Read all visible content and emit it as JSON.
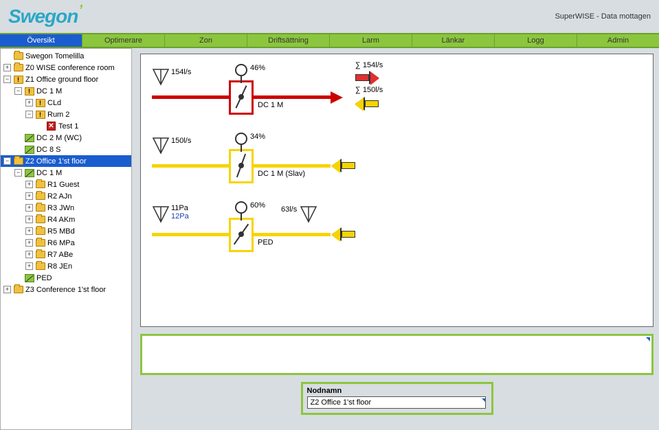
{
  "header": {
    "logo": "Swegon",
    "status": "SuperWISE - Data mottagen"
  },
  "nav": {
    "items": [
      "Översikt",
      "Optimerare",
      "Zon",
      "Driftsättning",
      "Larm",
      "Länkar",
      "Logg",
      "Admin"
    ],
    "activeIndex": 0
  },
  "tree": [
    {
      "lvl": 0,
      "toggle": "",
      "icon": "folder",
      "label": "Swegon Tomelilla"
    },
    {
      "lvl": 0,
      "toggle": "+",
      "icon": "folder",
      "label": "Z0 WISE conference room"
    },
    {
      "lvl": 0,
      "toggle": "-",
      "icon": "warn",
      "label": "Z1 Office ground floor"
    },
    {
      "lvl": 1,
      "toggle": "-",
      "icon": "warn",
      "label": "DC 1 M"
    },
    {
      "lvl": 2,
      "toggle": "+",
      "icon": "warn",
      "label": "CLd"
    },
    {
      "lvl": 2,
      "toggle": "-",
      "icon": "warn",
      "label": "Rum 2"
    },
    {
      "lvl": 3,
      "toggle": "",
      "icon": "error",
      "label": "Test 1"
    },
    {
      "lvl": 1,
      "toggle": "",
      "icon": "green",
      "label": "DC 2 M (WC)"
    },
    {
      "lvl": 1,
      "toggle": "",
      "icon": "green",
      "label": "DC 8 S"
    },
    {
      "lvl": 0,
      "toggle": "-",
      "icon": "folder",
      "label": "Z2 Office 1'st floor",
      "selected": true
    },
    {
      "lvl": 1,
      "toggle": "-",
      "icon": "green",
      "label": "DC 1 M"
    },
    {
      "lvl": 2,
      "toggle": "+",
      "icon": "folder",
      "label": "R1 Guest"
    },
    {
      "lvl": 2,
      "toggle": "+",
      "icon": "folder",
      "label": "R2 AJn"
    },
    {
      "lvl": 2,
      "toggle": "+",
      "icon": "folder",
      "label": "R3 JWn"
    },
    {
      "lvl": 2,
      "toggle": "+",
      "icon": "folder",
      "label": "R4 AKm"
    },
    {
      "lvl": 2,
      "toggle": "+",
      "icon": "folder",
      "label": "R5 MBd"
    },
    {
      "lvl": 2,
      "toggle": "+",
      "icon": "folder",
      "label": "R6 MPa"
    },
    {
      "lvl": 2,
      "toggle": "+",
      "icon": "folder",
      "label": "R7 ABe"
    },
    {
      "lvl": 2,
      "toggle": "+",
      "icon": "folder",
      "label": "R8 JEn"
    },
    {
      "lvl": 1,
      "toggle": "",
      "icon": "green",
      "label": "PED"
    },
    {
      "lvl": 0,
      "toggle": "+",
      "icon": "folder",
      "label": "Z3 Conference 1'st floor"
    }
  ],
  "diagram": {
    "row1": {
      "sensor": "154l/s",
      "damperPct": "46%",
      "name": "DC 1 M",
      "sum1": "∑ 154l/s",
      "sum2": "∑ 150l/s"
    },
    "row2": {
      "sensor": "150l/s",
      "damperPct": "34%",
      "name": "DC 1 M (Slav)"
    },
    "row3": {
      "sensor1": "11Pa",
      "sensor1b": "12Pa",
      "damperPct": "60%",
      "name": "PED",
      "sensor2": "63l/s"
    }
  },
  "nodnamn": {
    "label": "Nodnamn",
    "value": "Z2 Office 1'st floor"
  }
}
